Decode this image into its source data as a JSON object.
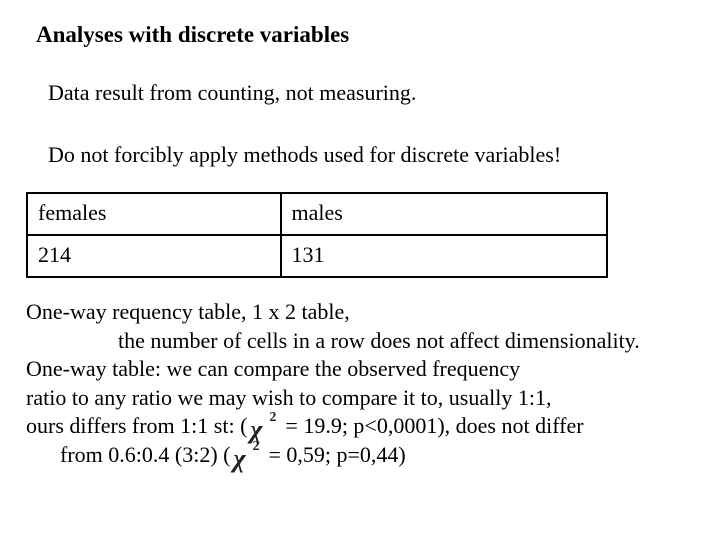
{
  "title": "Analyses with discrete variables",
  "para1": "Data result from counting, not measuring.",
  "para2": "Do not forcibly apply methods used for discrete variables!",
  "chart_data": {
    "type": "table",
    "categories": [
      "females",
      "males"
    ],
    "values": [
      214,
      131
    ],
    "title": "One-way frequency table (1 x 2)"
  },
  "table": {
    "header": {
      "c1": "females",
      "c2": "males"
    },
    "row": {
      "c1": "214",
      "c2": "131"
    }
  },
  "body": {
    "l1": "One-way requency table, 1 x 2 table,",
    "l2": "the number of cells in a row does not affect dimensionality.",
    "l3": "One-way table: we can compare the observed frequency",
    "l4": "ratio to any ratio we may wish to compare it to, usually 1:1,",
    "l5a": "ours differs from 1:1 st: ( ",
    "l5b": " =  19.9; p<0,0001), does not differ",
    "l6a": "from  0.6:0.4 (3:2)    ( ",
    "l6b": " =  0,59; p=0,44)"
  },
  "chi": {
    "glyph": "χ",
    "sup": "2"
  }
}
